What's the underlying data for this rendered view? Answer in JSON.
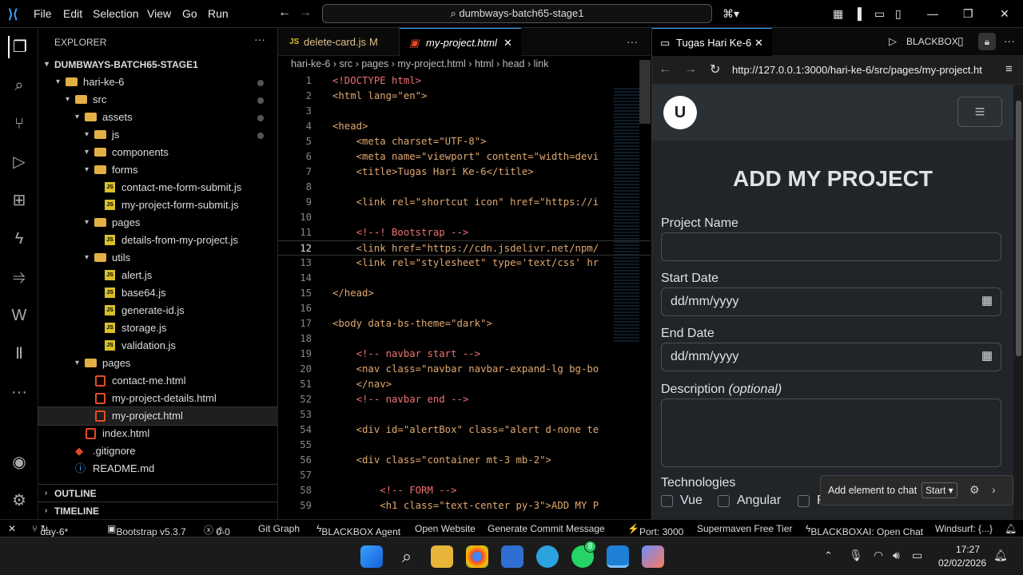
{
  "titlebar": {
    "menu": [
      "File",
      "Edit",
      "Selection",
      "View",
      "Go",
      "Run"
    ],
    "search": "dumbways-batch65-stage1"
  },
  "explorer": {
    "title": "EXPLORER",
    "root": "DUMBWAYS-BATCH65-STAGE1",
    "items": [
      {
        "label": "hari-ke-6",
        "type": "folder",
        "depth": 1
      },
      {
        "label": "src",
        "type": "folder",
        "depth": 2
      },
      {
        "label": "assets",
        "type": "folder",
        "depth": 3
      },
      {
        "label": "js",
        "type": "folder",
        "depth": 4
      },
      {
        "label": "components",
        "type": "folder",
        "depth": 4
      },
      {
        "label": "forms",
        "type": "folder",
        "depth": 4
      },
      {
        "label": "contact-me-form-submit.js",
        "type": "js",
        "depth": 5
      },
      {
        "label": "my-project-form-submit.js",
        "type": "js",
        "depth": 5
      },
      {
        "label": "pages",
        "type": "folder",
        "depth": 4
      },
      {
        "label": "details-from-my-project.js",
        "type": "js",
        "depth": 5
      },
      {
        "label": "utils",
        "type": "folder",
        "depth": 4
      },
      {
        "label": "alert.js",
        "type": "js",
        "depth": 5
      },
      {
        "label": "base64.js",
        "type": "js",
        "depth": 5
      },
      {
        "label": "generate-id.js",
        "type": "js",
        "depth": 5
      },
      {
        "label": "storage.js",
        "type": "js",
        "depth": 5
      },
      {
        "label": "validation.js",
        "type": "js",
        "depth": 5
      },
      {
        "label": "pages",
        "type": "folder",
        "depth": 3
      },
      {
        "label": "contact-me.html",
        "type": "html",
        "depth": 4
      },
      {
        "label": "my-project-details.html",
        "type": "html",
        "depth": 4
      },
      {
        "label": "my-project.html",
        "type": "html",
        "depth": 4
      },
      {
        "label": "index.html",
        "type": "html",
        "depth": 3
      },
      {
        "label": ".gitignore",
        "type": "git",
        "depth": 2
      },
      {
        "label": "README.md",
        "type": "info",
        "depth": 2
      }
    ],
    "outline": "OUTLINE",
    "timeline": "TIMELINE"
  },
  "editor": {
    "tabs": [
      {
        "label": "delete-card.js",
        "badge": "M"
      },
      {
        "label": "my-project.html"
      }
    ],
    "breadcrumb": [
      "hari-ke-6",
      "src",
      "pages",
      "my-project.html",
      "html",
      "head",
      "link"
    ],
    "lines": [
      {
        "n": "1",
        "t": "<!DOCTYPE html>"
      },
      {
        "n": "2",
        "t": "<html lang=\"en\">"
      },
      {
        "n": "3",
        "t": ""
      },
      {
        "n": "4",
        "t": "<head>"
      },
      {
        "n": "5",
        "t": "    <meta charset=\"UTF-8\">"
      },
      {
        "n": "6",
        "t": "    <meta name=\"viewport\" content=\"width=devi"
      },
      {
        "n": "7",
        "t": "    <title>Tugas Hari Ke-6</title>"
      },
      {
        "n": "8",
        "t": ""
      },
      {
        "n": "9",
        "t": "    <link rel=\"shortcut icon\" href=\"https://i"
      },
      {
        "n": "10",
        "t": ""
      },
      {
        "n": "11",
        "t": "    <!--! Bootstrap -->"
      },
      {
        "n": "12",
        "t": "    <link href=\"https://cdn.jsdelivr.net/npm/"
      },
      {
        "n": "13",
        "t": "    <link rel=\"stylesheet\" type='text/css' hr"
      },
      {
        "n": "14",
        "t": ""
      },
      {
        "n": "15",
        "t": "</head>"
      },
      {
        "n": "16",
        "t": ""
      },
      {
        "n": "17",
        "t": "<body data-bs-theme=\"dark\">"
      },
      {
        "n": "18",
        "t": ""
      },
      {
        "n": "19",
        "t": "    <!-- navbar start -->"
      },
      {
        "n": "20",
        "t": "    <nav class=\"navbar navbar-expand-lg bg-bo"
      },
      {
        "n": "51",
        "t": "    </nav>"
      },
      {
        "n": "52",
        "t": "    <!-- navbar end -->"
      },
      {
        "n": "53",
        "t": ""
      },
      {
        "n": "54",
        "t": "    <div id=\"alertBox\" class=\"alert d-none te"
      },
      {
        "n": "55",
        "t": ""
      },
      {
        "n": "56",
        "t": "    <div class=\"container mt-3 mb-2\">"
      },
      {
        "n": "57",
        "t": ""
      },
      {
        "n": "58",
        "t": "        <!-- FORM -->"
      },
      {
        "n": "59",
        "t": "        <h1 class=\"text-center py-3\">ADD MY P"
      }
    ]
  },
  "browser": {
    "tab": "Tugas Hari Ke-6",
    "blackbox": "BLACKBOX",
    "url": "http://127.0.0.1:3000/hari-ke-6/src/pages/my-project.ht",
    "heading": "ADD MY PROJECT",
    "project_name": "Project Name",
    "start_date": "Start Date",
    "end_date": "End Date",
    "date_placeholder": "dd/mm/yyyy",
    "description": "Description",
    "optional": "(optional)",
    "technologies": "Technologies",
    "tech": [
      "Vue",
      "Angular",
      "F"
    ],
    "chat_popup": "Add element to chat",
    "chat_start": "Start"
  },
  "status": {
    "branch": "day-6*",
    "bootstrap": "Bootstrap v5.3.7",
    "problems": "0",
    "warnings": "0",
    "git_graph": "Git Graph",
    "blackbox_agent": "BLACKBOX Agent",
    "open_website": "Open Website",
    "generate_commit": "Generate Commit Message",
    "port": "Port: 3000",
    "supermaven": "Supermaven Free Tier",
    "blackbox_chat": "BLACKBOXAI: Open Chat",
    "windsurf": "Windsurf: {...}"
  },
  "taskbar": {
    "time": "17:27",
    "date": "02/02/2026",
    "whatsapp_badge": "8"
  }
}
